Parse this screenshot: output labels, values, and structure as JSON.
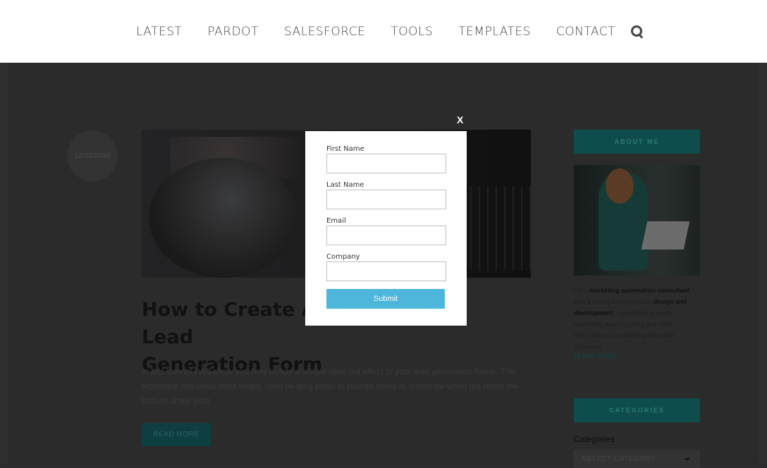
{
  "nav": {
    "items": [
      "LATEST",
      "PARDOT",
      "SALESFORCE",
      "TOOLS",
      "TEMPLATES",
      "CONTACT"
    ],
    "search_icon": "search-icon"
  },
  "post": {
    "date": "12/01/2016",
    "title": "How to Create A Slide-Out Lead Generation Form",
    "title_visible_left": "How to Create A S",
    "title_visible_right": "Lead",
    "title_line2": "Generation Form",
    "excerpt": "In this tutorial I will show you how to add a simple slide out effect to your lead generation forms. This technique has been most widely used on blog posts to prompt users to subscribe when the reach the bottom of the post.",
    "read_more": "READ MORE"
  },
  "sidebar": {
    "about_heading": "ABOUT ME",
    "about_text": {
      "part1": "I'm a ",
      "bold1": "marketing automation consultant",
      "part2": " with a strong background in ",
      "bold2": "design and development",
      "part3": ". I specialize in email marketing, lead nurturing and CRM integrations for marketing and sales alignment."
    },
    "about_link": "LEARN MORE",
    "categories_heading": "CATEGORIES",
    "categories_label": "Categories",
    "categories_select": "SELECT CATEGORY"
  },
  "modal": {
    "close": "X",
    "fields": [
      {
        "label": "First Name",
        "value": ""
      },
      {
        "label": "Last Name",
        "value": ""
      },
      {
        "label": "Email",
        "value": ""
      },
      {
        "label": "Company",
        "value": ""
      }
    ],
    "submit": "Submit"
  },
  "colors": {
    "accent_teal": "#0f4d4c",
    "submit_blue": "#4db6da",
    "overlay": "#2b2b2b"
  }
}
